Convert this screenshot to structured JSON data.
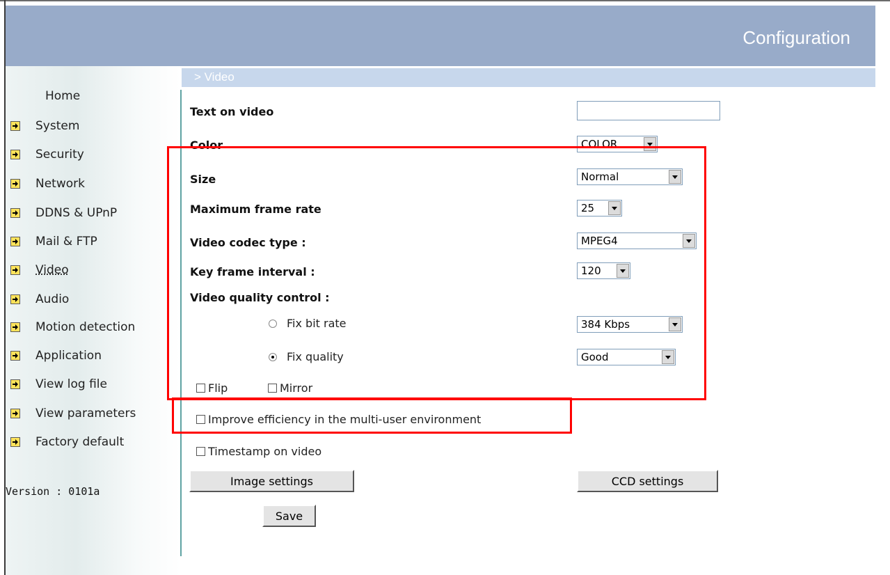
{
  "header": {
    "title": "Configuration"
  },
  "section": {
    "title": "> Video"
  },
  "sidebar": {
    "home": "Home",
    "items": [
      {
        "label": "System"
      },
      {
        "label": "Security"
      },
      {
        "label": "Network"
      },
      {
        "label": "DDNS & UPnP"
      },
      {
        "label": "Mail & FTP"
      },
      {
        "label": "Video"
      },
      {
        "label": "Audio"
      },
      {
        "label": "Motion detection"
      },
      {
        "label": "Application"
      },
      {
        "label": "View log file"
      },
      {
        "label": "View parameters"
      },
      {
        "label": "Factory default"
      }
    ],
    "active": "Video",
    "version": "Version : 0101a"
  },
  "form": {
    "text_on_video": {
      "label": "Text on video",
      "value": ""
    },
    "color": {
      "label": "Color",
      "selected": "COLOR"
    },
    "size": {
      "label": "Size",
      "selected": "Normal"
    },
    "max_frame_rate": {
      "label": "Maximum frame rate",
      "selected": "25"
    },
    "codec": {
      "label": "Video codec type :",
      "selected": "MPEG4"
    },
    "key_frame": {
      "label": "Key frame interval :",
      "selected": "120"
    },
    "quality_control": {
      "label": "Video quality control :",
      "fix_bit_rate": {
        "label": "Fix bit rate",
        "checked": false,
        "selected": "384 Kbps"
      },
      "fix_quality": {
        "label": "Fix quality",
        "checked": true,
        "selected": "Good"
      }
    },
    "flip": {
      "label": "Flip",
      "checked": false
    },
    "mirror": {
      "label": "Mirror",
      "checked": false
    },
    "improve_efficiency": {
      "label": "Improve efficiency in the multi-user environment",
      "checked": false
    },
    "timestamp": {
      "label": "Timestamp on video",
      "checked": false
    }
  },
  "buttons": {
    "image_settings": "Image settings",
    "ccd_settings": "CCD settings",
    "save": "Save"
  },
  "colors": {
    "header_bg": "#98abc9",
    "section_bg": "#c7d7ec",
    "highlight": "#ff0000",
    "sidebar_divider": "#5fa3a3"
  }
}
